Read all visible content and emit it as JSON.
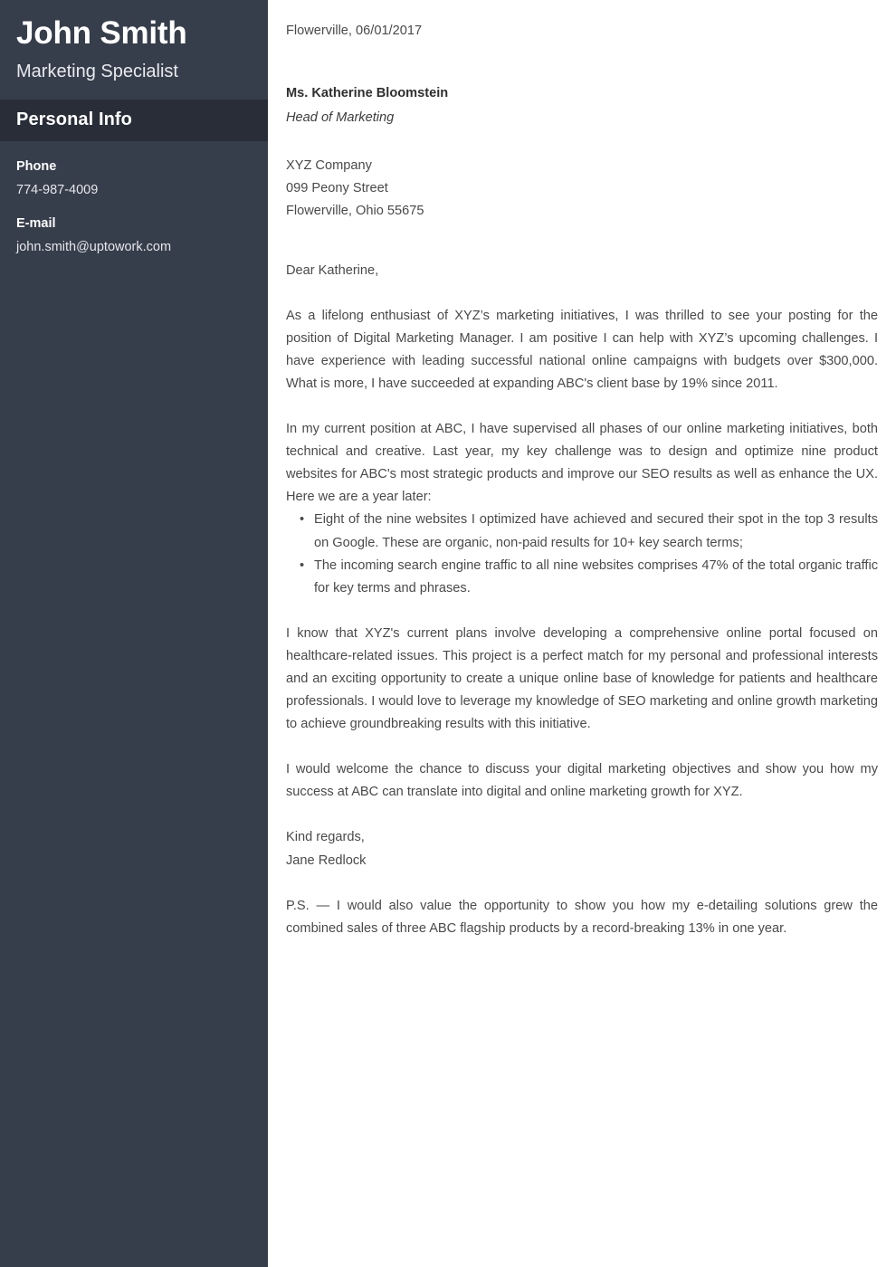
{
  "sidebar": {
    "name": "John Smith",
    "job_title": "Marketing Specialist",
    "section_title": "Personal Info",
    "contacts": [
      {
        "label": "Phone",
        "value": "774-987-4009"
      },
      {
        "label": "E-mail",
        "value": "john.smith@uptowork.com"
      }
    ],
    "colors": {
      "background": "#373e4b",
      "band_background": "#282d38",
      "text": "#ffffff"
    }
  },
  "letter": {
    "date_line": "Flowerville, 06/01/2017",
    "recipient": {
      "name": "Ms. Katherine Bloomstein",
      "role": "Head of Marketing"
    },
    "company": {
      "name": "XYZ Company",
      "street": "099 Peony Street",
      "city_state_zip": "Flowerville, Ohio 55675"
    },
    "salutation": "Dear Katherine,",
    "paragraph_1": "As a lifelong enthusiast of XYZ’s marketing initiatives, I was thrilled to see your posting for the position of Digital Marketing Manager. I am positive I can help with XYZ’s upcoming challenges. I have experience with leading successful national online campaigns with budgets over $300,000. What is more, I have succeeded at expanding ABC's client base by 19% since 2011.",
    "paragraph_2": "In my current position at ABC, I have supervised all phases of our online marketing initiatives, both technical and creative. Last year, my key challenge was to design and optimize nine product websites for ABC's most strategic products and improve our SEO results as well as enhance the UX. Here we are a year later:",
    "bullets": [
      "Eight of the nine websites I optimized have achieved and secured their spot in the top 3 results on Google. These are organic, non-paid results for 10+ key search terms;",
      "The incoming search engine traffic to all nine websites comprises 47% of the total organic traffic for key terms and phrases."
    ],
    "bullet_marker": "•",
    "paragraph_3": "I know that XYZ's current plans involve developing a comprehensive online portal focused on healthcare-related issues. This project is a perfect match for my personal and professional interests and an exciting opportunity to create a unique online base of knowledge for patients and healthcare professionals. I would love to leverage my knowledge of SEO marketing and online growth marketing to achieve groundbreaking results with this initiative.",
    "paragraph_4": "I would welcome the chance to discuss your digital marketing objectives and show you how my success at ABC can translate into digital and online marketing growth for XYZ.",
    "closing_phrase": "Kind regards,",
    "signature_name": "Jane Redlock",
    "postscript": "P.S. — I would also value the opportunity to show you how my e-detailing solutions grew the combined sales of three ABC flagship products by a record-breaking 13% in one year."
  }
}
